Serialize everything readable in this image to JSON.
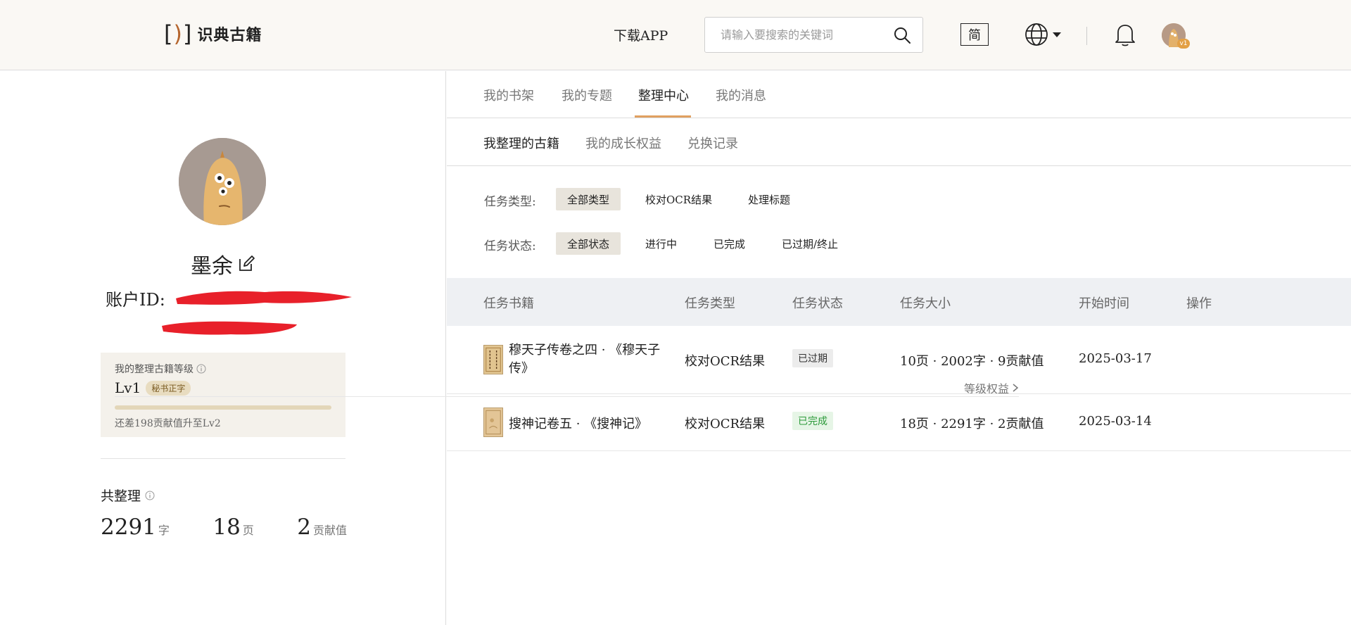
{
  "header": {
    "logo_text": "识典古籍",
    "download_label": "下载APP",
    "search_placeholder": "请输入要搜索的关键词",
    "simplified_label": "简",
    "avatar_level": "v1"
  },
  "profile": {
    "nickname": "墨余",
    "account_label": "账户ID:",
    "level_card": {
      "title": "我的整理古籍等级",
      "level": "Lv1",
      "level_badge": "秘书正字",
      "rights_label": "等级权益",
      "progress_fraction": 0.0,
      "hint": "还差198贡献值升至Lv2"
    },
    "total_title": "共整理",
    "stats": [
      {
        "value": "2291",
        "unit": "字"
      },
      {
        "value": "18",
        "unit": "页"
      },
      {
        "value": "2",
        "unit": "贡献值"
      }
    ]
  },
  "tabs": [
    "我的书架",
    "我的专题",
    "整理中心",
    "我的消息"
  ],
  "active_tab": "整理中心",
  "subtabs": [
    "我整理的古籍",
    "我的成长权益",
    "兑换记录"
  ],
  "filters": {
    "type_label": "任务类型:",
    "type_options": [
      "全部类型",
      "校对OCR结果",
      "处理标题"
    ],
    "status_label": "任务状态:",
    "status_options": [
      "全部状态",
      "进行中",
      "已完成",
      "已过期/终止"
    ]
  },
  "table": {
    "headers": [
      "任务书籍",
      "任务类型",
      "任务状态",
      "任务大小",
      "开始时间",
      "操作"
    ],
    "rows": [
      {
        "book_line1": "穆天子传卷之四 · 《穆天子",
        "book_line2": "传》",
        "type": "校对OCR结果",
        "status": "已过期",
        "size": "10页 · 2002字 · 9贡献值",
        "start": "2025-03-17"
      },
      {
        "book_line1": "搜神记卷五 · 《搜神记》",
        "type": "校对OCR结果",
        "status": "已完成",
        "size": "18页 · 2291字 · 2贡献值",
        "start": "2025-03-14"
      }
    ]
  },
  "colors": {
    "accent": "#e0a060",
    "redaction": "#e8202a",
    "done_green": "#2c9a3a"
  }
}
